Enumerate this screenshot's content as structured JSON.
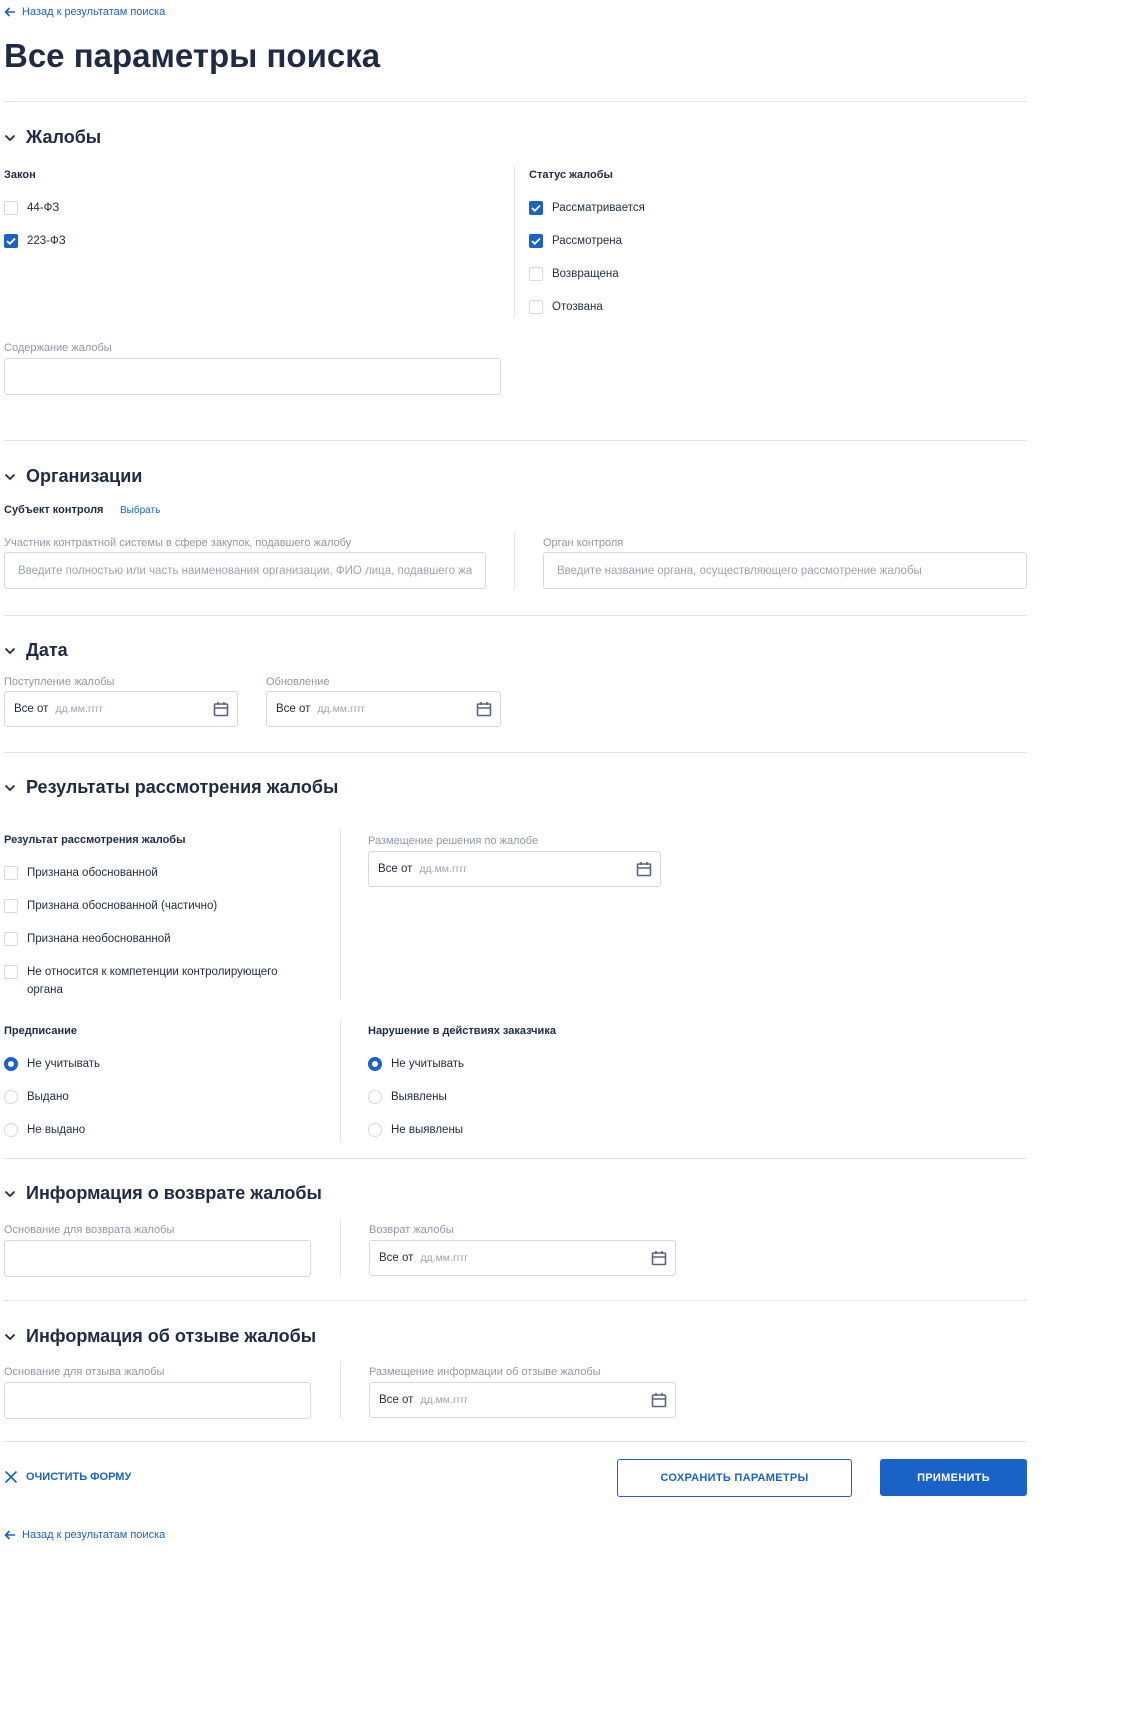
{
  "nav": {
    "back_link": "Назад к результатам поиска"
  },
  "page_title": "Все параметры поиска",
  "sections": {
    "complaints": {
      "title": "Жалобы",
      "law": {
        "label": "Закон",
        "options": [
          {
            "label": "44-ФЗ",
            "checked": false
          },
          {
            "label": "223-ФЗ",
            "checked": true
          }
        ]
      },
      "status": {
        "label": "Статус жалобы",
        "options": [
          {
            "label": "Рассматривается",
            "checked": true
          },
          {
            "label": "Рассмотрена",
            "checked": true
          },
          {
            "label": "Возвращена",
            "checked": false
          },
          {
            "label": "Отозвана",
            "checked": false
          }
        ]
      },
      "content": {
        "label": "Содержание жалобы",
        "value": ""
      }
    },
    "organizations": {
      "title": "Организации",
      "subject": {
        "label": "Субъект контроля",
        "choose_link": "Выбрать"
      },
      "participant": {
        "label": "Участник контрактной системы в сфере закупок, подавшего жалобу",
        "placeholder": "Введите полностью или часть наименования организации, ФИО лица, подавшего жалобу"
      },
      "authority": {
        "label": "Орган контроля",
        "placeholder": "Введите название органа, осуществляющего рассмотрение жалобы"
      }
    },
    "date": {
      "title": "Дата",
      "received": {
        "label": "Поступление жалобы",
        "prefix": "Все от",
        "placeholder": "дд.мм.гггг"
      },
      "updated": {
        "label": "Обновление",
        "prefix": "Все от",
        "placeholder": "дд.мм.гггг"
      }
    },
    "results": {
      "title": "Результаты рассмотрения жалобы",
      "result": {
        "label": "Результат рассмотрения жалобы",
        "options": [
          {
            "label": "Признана обоснованной",
            "checked": false
          },
          {
            "label": "Признана обоснованной (частично)",
            "checked": false
          },
          {
            "label": "Признана необоснованной",
            "checked": false
          },
          {
            "label": "Не относится к компетенции контролирующего органа",
            "checked": false
          }
        ]
      },
      "decision_date": {
        "label": "Размещение решения по жалобе",
        "prefix": "Все от",
        "placeholder": "дд.мм.гггг"
      },
      "prescription": {
        "label": "Предписание",
        "options": [
          {
            "label": "Не учитывать",
            "selected": true
          },
          {
            "label": "Выдано",
            "selected": false
          },
          {
            "label": "Не выдано",
            "selected": false
          }
        ]
      },
      "violation": {
        "label": "Нарушение в действиях заказчика",
        "options": [
          {
            "label": "Не учитывать",
            "selected": true
          },
          {
            "label": "Выявлены",
            "selected": false
          },
          {
            "label": "Не выявлены",
            "selected": false
          }
        ]
      }
    },
    "return_info": {
      "title": "Информация о возврате жалобы",
      "basis": {
        "label": "Основание для возврата жалобы",
        "value": ""
      },
      "date": {
        "label": "Возврат жалобы",
        "prefix": "Все от",
        "placeholder": "дд.мм.гггг"
      }
    },
    "withdrawal_info": {
      "title": "Информация об отзыве жалобы",
      "basis": {
        "label": "Основание для отзыва жалобы",
        "value": ""
      },
      "date": {
        "label": "Размещение информации об отзыве жалобы",
        "prefix": "Все от",
        "placeholder": "дд.мм.гггг"
      }
    }
  },
  "actions": {
    "clear": "ОЧИСТИТЬ ФОРМУ",
    "save": "СОХРАНИТЬ ПАРАМЕТРЫ",
    "apply": "ПРИМЕНИТЬ"
  },
  "colors": {
    "accent": "#1a62c5",
    "text": "#1f2a44",
    "muted": "#8e97a8",
    "border": "#d4d9e1",
    "divider": "#dfe3ea"
  },
  "icons": {
    "back": "arrow-left-icon",
    "section_toggle": "chevron-down-icon",
    "calendar": "calendar-icon",
    "clear": "close-icon",
    "check": "check-icon"
  }
}
